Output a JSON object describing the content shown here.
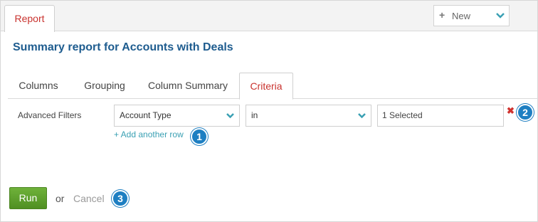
{
  "header": {
    "tab_label": "Report",
    "new_button_label": "New",
    "plus_glyph": "+"
  },
  "page": {
    "title": "Summary report for Accounts with Deals"
  },
  "tabs": [
    {
      "label": "Columns"
    },
    {
      "label": "Grouping"
    },
    {
      "label": "Column Summary"
    },
    {
      "label": "Criteria"
    }
  ],
  "filters": {
    "label": "Advanced Filters",
    "field_value": "Account Type",
    "operator_value": "in",
    "value_text": "1 Selected",
    "remove_glyph": "✖",
    "add_row_label": "+ Add another row"
  },
  "callouts": [
    "1",
    "2",
    "3"
  ],
  "actions": {
    "run_label": "Run",
    "or_text": "or",
    "cancel_label": "Cancel"
  },
  "colors": {
    "accent_red": "#c9332f",
    "title_blue": "#1e5c8f",
    "link_teal": "#3aa0b3",
    "callout_blue": "#1e7fc2",
    "run_green": "#5a9e2c"
  },
  "icons": {
    "new_button_plus": "plus-icon",
    "dropdown": "chevron-down-icon",
    "remove": "close-icon"
  }
}
